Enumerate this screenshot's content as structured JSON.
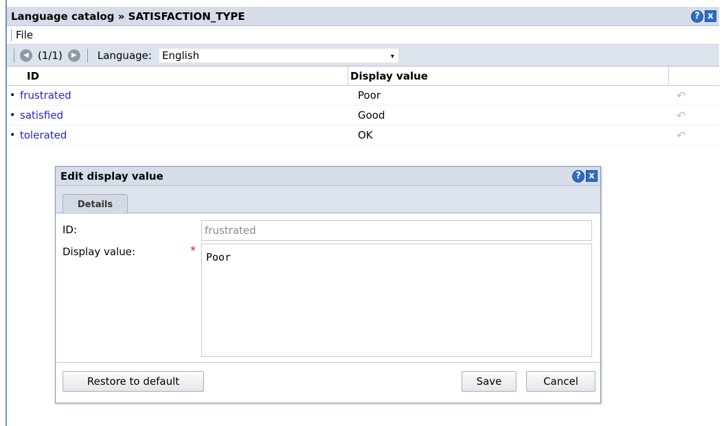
{
  "window": {
    "title": "Language catalog » SATISFACTION_TYPE",
    "help": "?",
    "close": "x"
  },
  "menu": {
    "file": "File"
  },
  "nav": {
    "prev": "◀",
    "next": "▶",
    "page": "(1/1)",
    "language_label": "Language:",
    "language_value": "English",
    "caret": "▾"
  },
  "table": {
    "headers": {
      "id": "ID",
      "display_value": "Display value"
    },
    "rows": [
      {
        "id": "frustrated",
        "display_value": "Poor"
      },
      {
        "id": "satisfied",
        "display_value": "Good"
      },
      {
        "id": "tolerated",
        "display_value": "OK"
      }
    ],
    "bullet": "•",
    "undo_glyph": "↶"
  },
  "dialog": {
    "title": "Edit display value",
    "help": "?",
    "close": "x",
    "tab": "Details",
    "id_label": "ID:",
    "id_value": "frustrated",
    "display_label": "Display value:",
    "required": "*",
    "display_value": "Poor",
    "restore_button": "Restore to default",
    "save_button": "Save",
    "cancel_button": "Cancel"
  },
  "colors": {
    "link": "#2323d8",
    "title_bar": "#d6dde8",
    "accent_button": "#2f6cc5",
    "required": "#d21a1a"
  }
}
